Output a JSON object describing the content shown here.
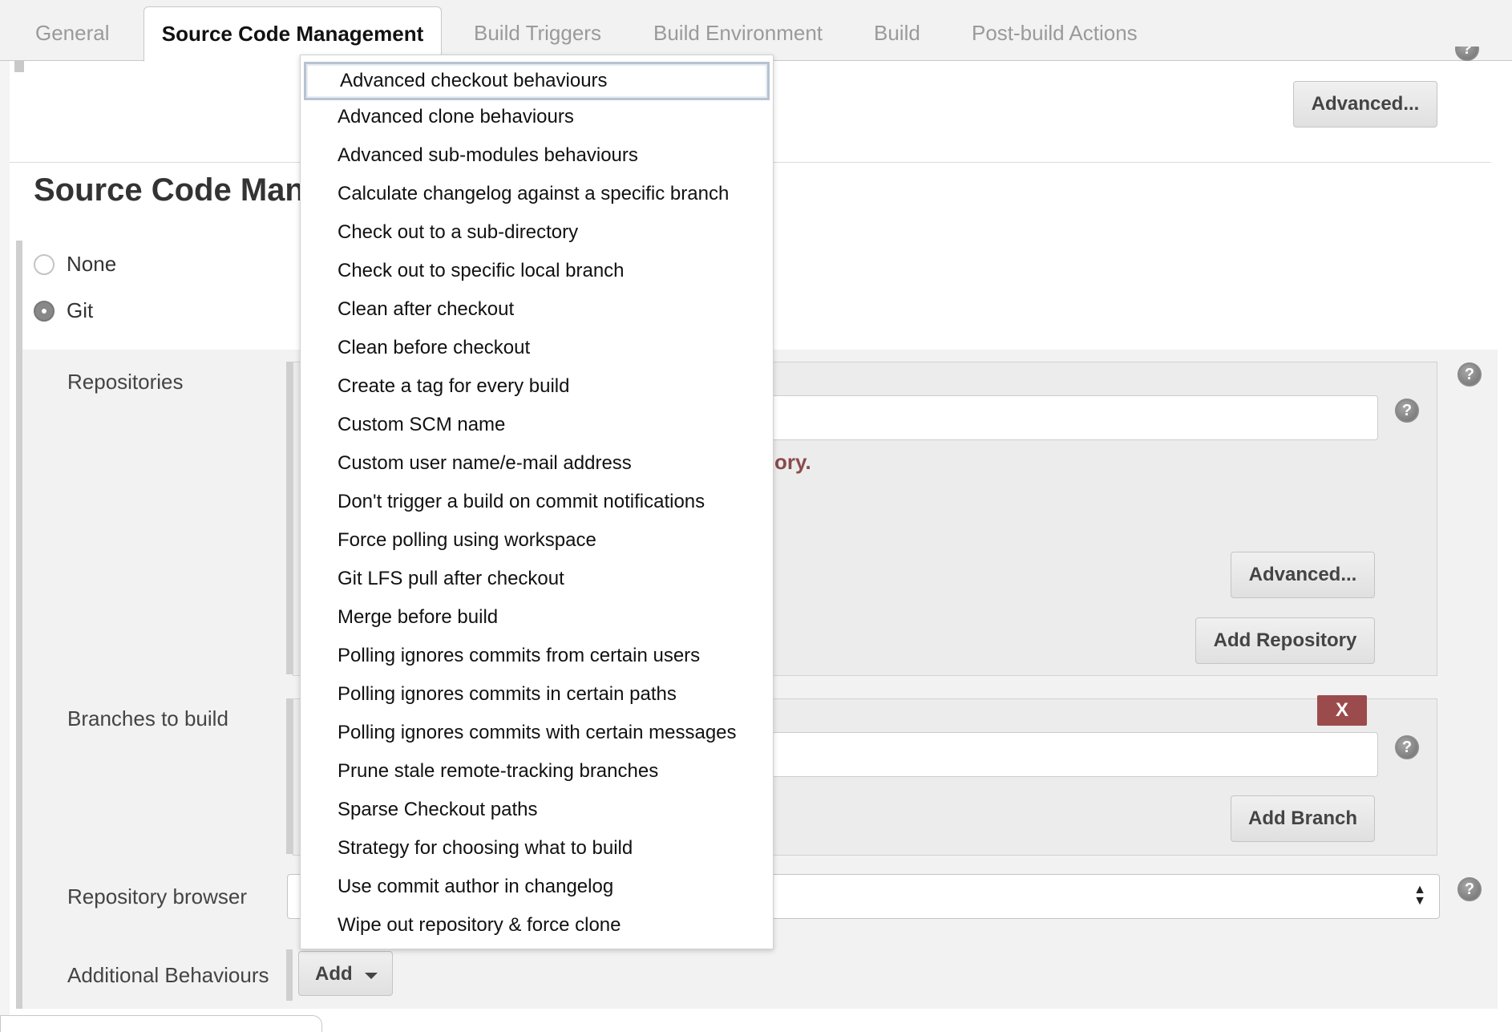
{
  "tabs": [
    {
      "label": "General",
      "active": false
    },
    {
      "label": "Source Code Management",
      "active": true
    },
    {
      "label": "Build Triggers",
      "active": false
    },
    {
      "label": "Build Environment",
      "active": false
    },
    {
      "label": "Build",
      "active": false
    },
    {
      "label": "Post-build Actions",
      "active": false
    }
  ],
  "top": {
    "advanced_label": "Advanced..."
  },
  "section": {
    "title": "Source Code Man"
  },
  "scm_options": [
    {
      "label": "None",
      "checked": false
    },
    {
      "label": "Git",
      "checked": true
    }
  ],
  "repositories": {
    "label": "Repositories",
    "error_text": "ory.",
    "advanced_label": "Advanced...",
    "add_repository_label": "Add Repository"
  },
  "branches": {
    "label": "Branches to build",
    "delete_label": "X",
    "add_branch_label": "Add Branch"
  },
  "repository_browser": {
    "label": "Repository browser",
    "selected_value": ""
  },
  "additional_behaviours": {
    "label": "Additional Behaviours",
    "add_label": "Add"
  },
  "dropdown": {
    "selected_index": 0,
    "items": [
      "Advanced checkout behaviours",
      "Advanced clone behaviours",
      "Advanced sub-modules behaviours",
      "Calculate changelog against a specific branch",
      "Check out to a sub-directory",
      "Check out to specific local branch",
      "Clean after checkout",
      "Clean before checkout",
      "Create a tag for every build",
      "Custom SCM name",
      "Custom user name/e-mail address",
      "Don't trigger a build on commit notifications",
      "Force polling using workspace",
      "Git LFS pull after checkout",
      "Merge before build",
      "Polling ignores commits from certain users",
      "Polling ignores commits in certain paths",
      "Polling ignores commits with certain messages",
      "Prune stale remote-tracking branches",
      "Sparse Checkout paths",
      "Strategy for choosing what to build",
      "Use commit author in changelog",
      "Wipe out repository & force clone"
    ]
  },
  "help_icon_glyph": "?",
  "colors": {
    "accent_error": "#8a4a4a",
    "delete_button": "#9b4b4b",
    "selected_outline": "#b7c3d1"
  }
}
